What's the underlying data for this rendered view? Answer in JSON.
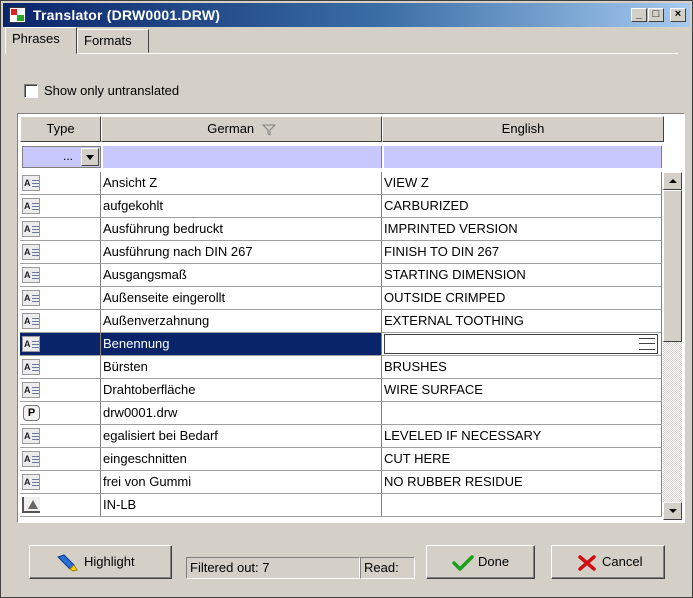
{
  "window": {
    "title": "Translator (DRW0001.DRW)",
    "controls": {
      "minimize": "_",
      "maximize": "□",
      "close": "×"
    }
  },
  "tabs": [
    {
      "label": "Phrases",
      "active": true
    },
    {
      "label": "Formats",
      "active": false
    }
  ],
  "filter_option": {
    "label": "Show only untranslated",
    "checked": false
  },
  "grid": {
    "columns": [
      {
        "label": "Type"
      },
      {
        "label": "German",
        "filter_icon": "funnel-icon"
      },
      {
        "label": "English"
      }
    ],
    "filter_row": {
      "type_value": "...",
      "german": "",
      "english": ""
    },
    "rows": [
      {
        "type": "phrase",
        "german": "Ansicht Z",
        "english": "VIEW Z"
      },
      {
        "type": "phrase",
        "german": "aufgekohlt",
        "english": "CARBURIZED"
      },
      {
        "type": "phrase",
        "german": "Ausführung bedruckt",
        "english": "IMPRINTED VERSION"
      },
      {
        "type": "phrase",
        "german": "Ausführung nach DIN 267",
        "english": "FINISH TO DIN 267"
      },
      {
        "type": "phrase",
        "german": "Ausgangsmaß",
        "english": "STARTING DIMENSION"
      },
      {
        "type": "phrase",
        "german": "Außenseite eingerollt",
        "english": "OUTSIDE CRIMPED"
      },
      {
        "type": "phrase",
        "german": "Außenverzahnung",
        "english": "EXTERNAL TOOTHING"
      },
      {
        "type": "phrase",
        "german": "Benennung",
        "english": "",
        "selected": true,
        "editing": true
      },
      {
        "type": "phrase",
        "german": "Bürsten",
        "english": "BRUSHES"
      },
      {
        "type": "phrase",
        "german": "Drahtoberfläche",
        "english": "WIRE SURFACE"
      },
      {
        "type": "parameter",
        "german": "drw0001.drw",
        "english": ""
      },
      {
        "type": "phrase",
        "german": "egalisiert bei Bedarf",
        "english": "LEVELED IF NECESSARY"
      },
      {
        "type": "phrase",
        "german": "eingeschnitten",
        "english": "CUT HERE"
      },
      {
        "type": "phrase",
        "german": "frei von Gummi",
        "english": "NO RUBBER RESIDUE"
      },
      {
        "type": "symbol",
        "german": "IN-LB",
        "english": ""
      }
    ],
    "type_icon_text": {
      "parameter": "P"
    }
  },
  "footer": {
    "highlight_label": "Highlight",
    "filtered_status": "Filtered out: 7",
    "read_status": "Read:",
    "done_label": "Done",
    "cancel_label": "Cancel"
  },
  "colors": {
    "titlebar_start": "#0a246a",
    "selection": "#0a246a",
    "filter_row": "#c8c8ff",
    "done_check": "#1aa01a",
    "cancel_x": "#d01010"
  }
}
